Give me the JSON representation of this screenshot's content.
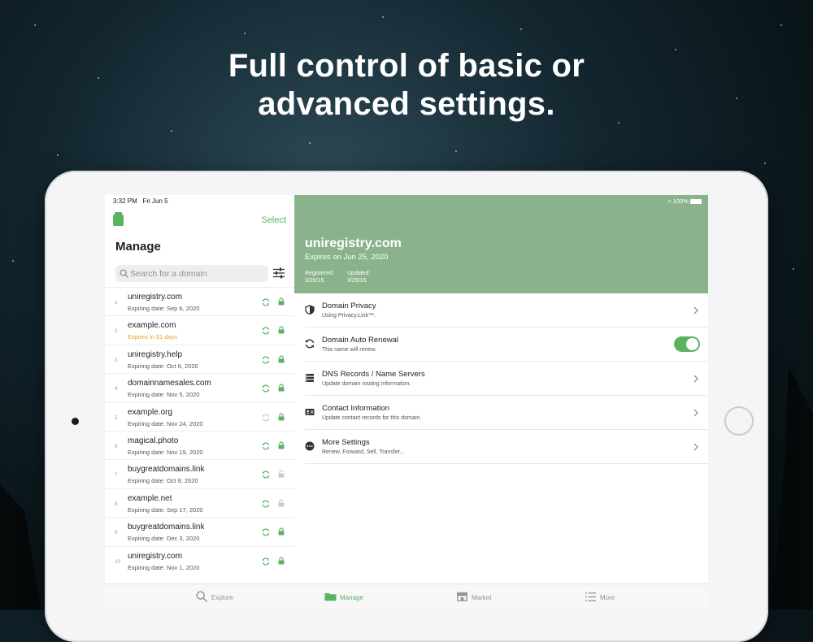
{
  "headline": {
    "line1": "Full control of basic or",
    "line2": "advanced settings."
  },
  "status": {
    "time": "3:32 PM   Fri Jun 5",
    "battery": "100%"
  },
  "left": {
    "select_label": "Select",
    "title": "Manage",
    "search_placeholder": "Search for a domain",
    "domains": [
      {
        "num": "1",
        "name": "uniregistry.com",
        "sub": "Expiring date: Sep 6, 2020",
        "warn": false,
        "locked": true,
        "renew": true
      },
      {
        "num": "2",
        "name": "example.com",
        "sub": "Expires in 51 days",
        "warn": true,
        "locked": true,
        "renew": true
      },
      {
        "num": "3",
        "name": "uniregistry.help",
        "sub": "Expiring date: Oct 6, 2020",
        "warn": false,
        "locked": true,
        "renew": true
      },
      {
        "num": "4",
        "name": "domainnamesales.com",
        "sub": "Expiring date: Nov 5, 2020",
        "warn": false,
        "locked": true,
        "renew": true
      },
      {
        "num": "5",
        "name": "example.org",
        "sub": "Expiring date: Nov 24, 2020",
        "warn": false,
        "locked": true,
        "renew": false
      },
      {
        "num": "6",
        "name": "magical.photo",
        "sub": "Expiring date: Nov 19, 2020",
        "warn": false,
        "locked": true,
        "renew": true
      },
      {
        "num": "7",
        "name": "buygreatdomains.link",
        "sub": "Expiring date: Oct 8, 2020",
        "warn": false,
        "locked": false,
        "renew": true
      },
      {
        "num": "8",
        "name": "example.net",
        "sub": "Expiring date: Sep 17, 2020",
        "warn": false,
        "locked": false,
        "renew": true
      },
      {
        "num": "9",
        "name": "buygreatdomains.link",
        "sub": "Expiring date: Dec 3, 2020",
        "warn": false,
        "locked": true,
        "renew": true
      },
      {
        "num": "10",
        "name": "uniregistry.com",
        "sub": "Expiring date: Nov 1, 2020",
        "warn": false,
        "locked": true,
        "renew": true
      }
    ]
  },
  "detail": {
    "domain": "uniregistry.com",
    "expires": "Expires on Jun 25, 2020",
    "registered_label": "Registered:",
    "registered_value": "3/29/15",
    "updated_label": "Updated:",
    "updated_value": "3/29/15",
    "settings": [
      {
        "key": "privacy",
        "icon": "shield-icon",
        "title": "Domain Privacy",
        "sub": "Using Privacy.Link™."
      },
      {
        "key": "renewal",
        "icon": "renew-icon",
        "title": "Domain Auto Renewal",
        "sub": "This name will renew.",
        "toggle": true
      },
      {
        "key": "dns",
        "icon": "server-icon",
        "title": "DNS Records / Name Servers",
        "sub": "Update domain routing information."
      },
      {
        "key": "contact",
        "icon": "contact-card-icon",
        "title": "Contact Information",
        "sub": "Update contact records for this domain."
      },
      {
        "key": "more",
        "icon": "more-icon",
        "title": "More Settings",
        "sub": "Renew, Forward, Sell, Transfer..."
      }
    ]
  },
  "tabs": [
    {
      "label": "Explore",
      "icon": "search-icon",
      "active": false
    },
    {
      "label": "Manage",
      "icon": "folder-icon",
      "active": true
    },
    {
      "label": "Market",
      "icon": "store-icon",
      "active": false
    },
    {
      "label": "More",
      "icon": "list-icon",
      "active": false
    }
  ],
  "colors": {
    "accent": "#5bb35f",
    "header": "#8ab38c",
    "warning": "#f0a020"
  }
}
